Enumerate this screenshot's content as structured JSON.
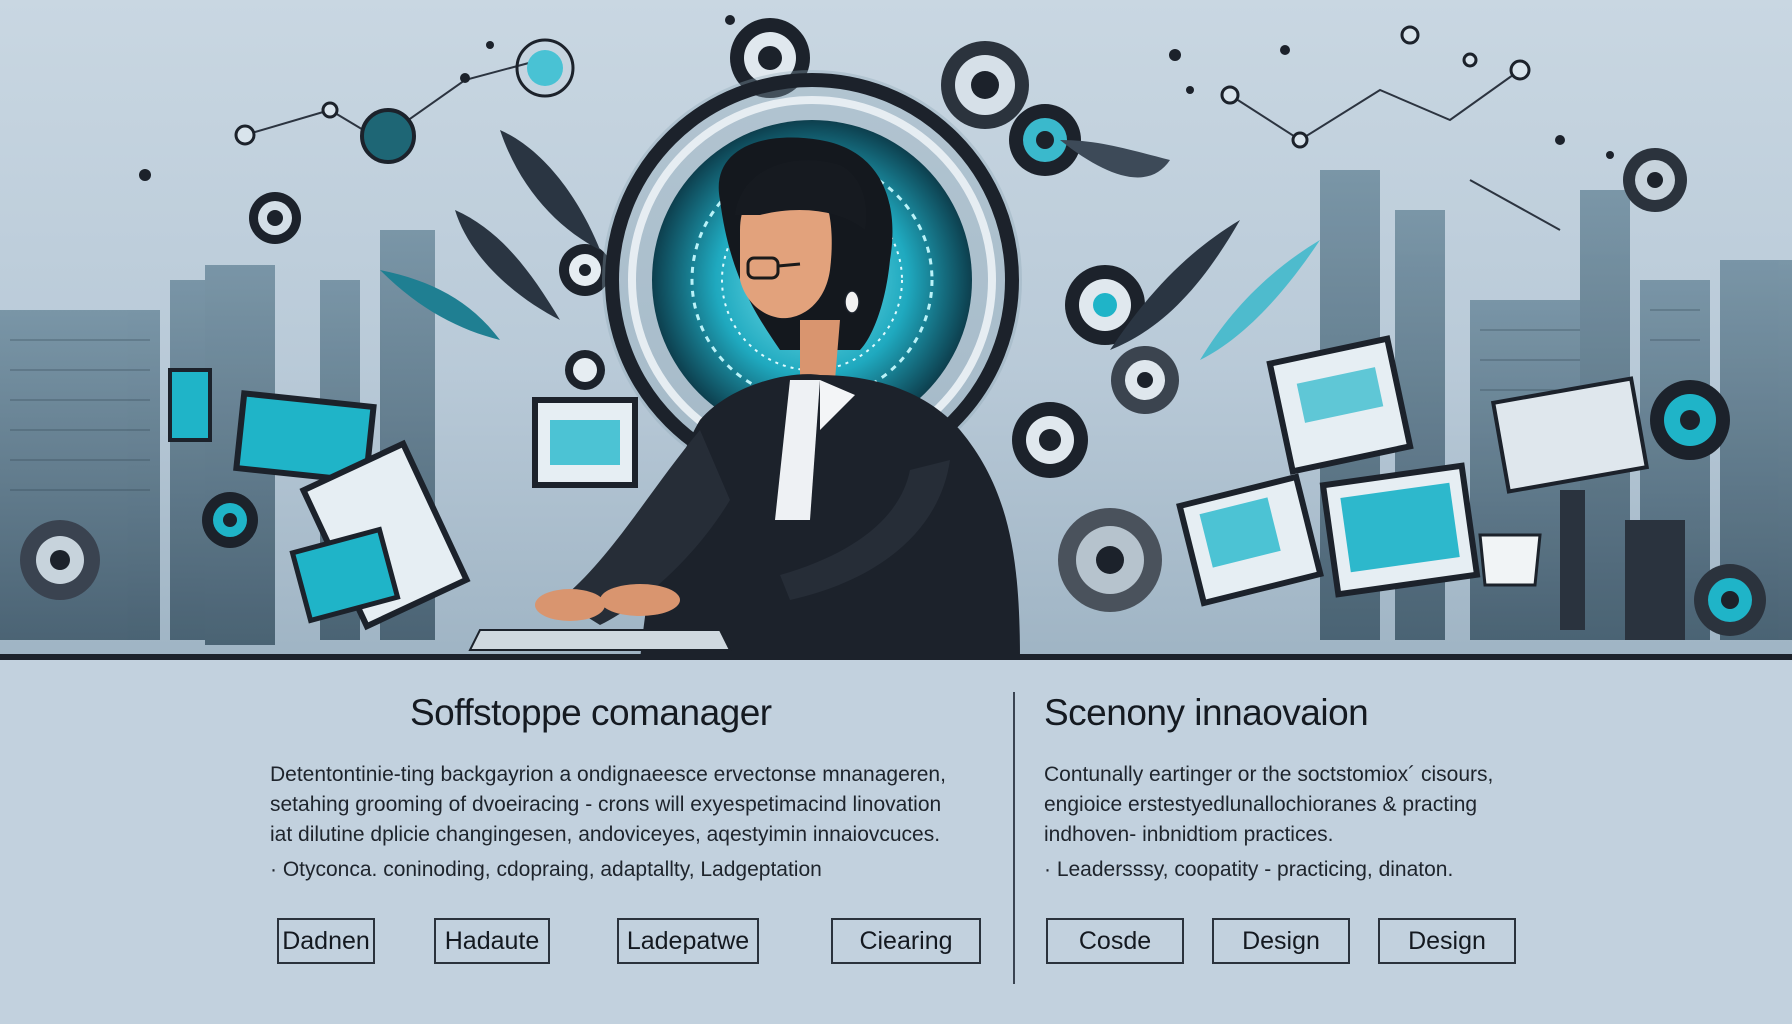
{
  "left": {
    "title": "Soffstoppe comanager",
    "desc_lines": [
      "Detentontinie-ting backgayrion a ondignaeesce ervectonse mnanageren,",
      "setahing grooming of dvoeiracing - crons will exyespetimacind linovation",
      "iat dilutine dplicie changingesen, andoviceyes, aqestyimin innaiovcuces."
    ],
    "bullets": "· Otyconca.  coninoding,  cdopraing,  adaptallty,  Ladgeptation",
    "buttons": [
      "Dadnen",
      "Hadaute",
      "Ladepatwe",
      "Ciearing"
    ]
  },
  "right": {
    "title": "Scenony innaovaion",
    "desc_lines": [
      "Contunally eartinger or the soctstomiox´  cisours,",
      "engioice erstestyedlunallochioranes & practing",
      "indhoven- inbnidtiom practices."
    ],
    "bullets": "·  Leadersssy,  coopatity   - practicing,  dinaton.",
    "buttons": [
      "Cosde",
      "Design",
      "Design"
    ]
  },
  "colors": {
    "accent": "#1fb4c8",
    "dark": "#1c222b",
    "panel": "#c2d1de"
  }
}
